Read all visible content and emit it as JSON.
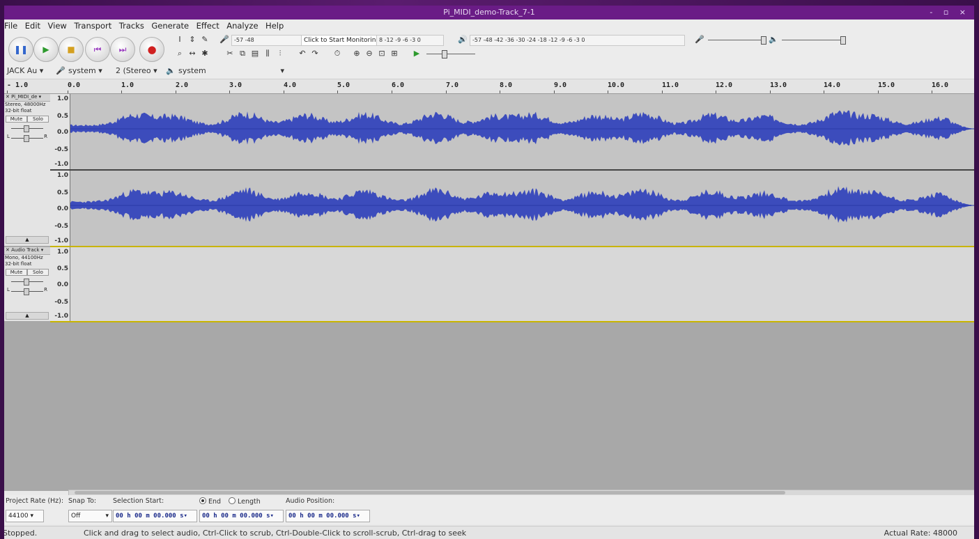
{
  "window": {
    "title": "Pi_MIDI_demo-Track_7-1",
    "controls": "- ▫ ×"
  },
  "menu": [
    "File",
    "Edit",
    "View",
    "Transport",
    "Tracks",
    "Generate",
    "Effect",
    "Analyze",
    "Help"
  ],
  "transport": [
    {
      "name": "pause-button",
      "icon": "pause-icon",
      "glyph": "❚❚",
      "color": "#3366cc"
    },
    {
      "name": "play-button",
      "icon": "play-icon",
      "glyph": "▶",
      "color": "#2e9a2e"
    },
    {
      "name": "stop-button",
      "icon": "stop-icon",
      "glyph": "■",
      "color": "#d4a020"
    },
    {
      "name": "skip-start-button",
      "icon": "skip-start-icon",
      "glyph": "⏮",
      "color": "#9a3cc0"
    },
    {
      "name": "skip-end-button",
      "icon": "skip-end-icon",
      "glyph": "⏭",
      "color": "#9a3cc0"
    },
    {
      "name": "record-button",
      "icon": "record-icon",
      "glyph": "●",
      "color": "#d02020"
    }
  ],
  "meters": {
    "record_scale": "-57      -48",
    "monitor_prompt": "Click to Start Monitoring",
    "record_scale_right": "8   -12 -9 -6 -3 0",
    "play_scale": "-57      -48    -42    -36    -30    -24    -18    -12 -9 -6 -3 0"
  },
  "devices": {
    "host": "JACK Au",
    "record_device": "system",
    "channels": "2 (Stereo",
    "playback_device": "system"
  },
  "ruler": [
    "- 1.0",
    "0.0",
    "1.0",
    "2.0",
    "3.0",
    "4.0",
    "5.0",
    "6.0",
    "7.0",
    "8.0",
    "9.0",
    "10.0",
    "11.0",
    "12.0",
    "13.0",
    "14.0",
    "15.0",
    "16.0"
  ],
  "track1": {
    "name": "Pi_MIDI_de",
    "info1": "Stereo, 48000Hz",
    "info2": "32-bit float",
    "mute": "Mute",
    "solo": "Solo",
    "scale": [
      "1.0",
      "0.5",
      "0.0",
      "-0.5",
      "-1.0"
    ]
  },
  "track2": {
    "name": "Audio Track",
    "info1": "Mono, 44100Hz",
    "info2": "32-bit float",
    "mute": "Mute",
    "solo": "Solo",
    "scale": [
      "1.0",
      "0.5",
      "0.0",
      "-0.5",
      "-1.0"
    ]
  },
  "selection": {
    "project_rate_label": "Project Rate (Hz):",
    "project_rate": "44100",
    "snap_label": "Snap To:",
    "snap_value": "Off",
    "sel_start_label": "Selection Start:",
    "end_label": "End",
    "length_label": "Length",
    "sel_start": "00 h 00 m 00.000 s",
    "sel_end": "00 h 00 m 00.000 s",
    "audio_pos_label": "Audio Position:",
    "audio_pos": "00 h 00 m 00.000 s"
  },
  "status": {
    "state": "Stopped.",
    "hint": "Click and drag to select audio, Ctrl-Click to scrub, Ctrl-Double-Click to scroll-scrub, Ctrl-drag to seek",
    "rate": "Actual Rate: 48000"
  },
  "colors": {
    "title_bar": "#6a1c86",
    "waveform": "#3c4cbc",
    "clip": "#c4c4c4"
  }
}
